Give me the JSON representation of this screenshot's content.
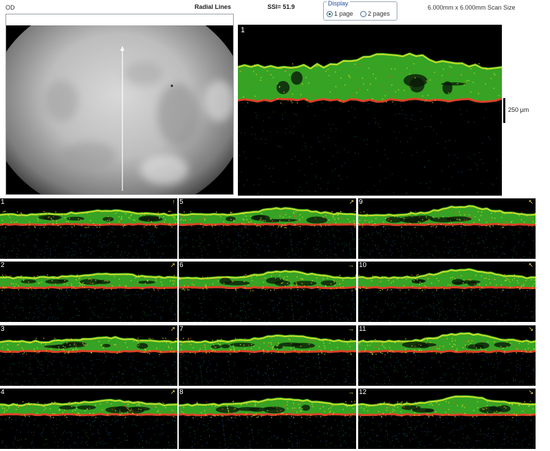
{
  "header": {
    "eye_label": "OD",
    "scan_pattern": "Radial Lines",
    "ssi": "SSI= 51.9",
    "scan_size": "6.000mm x 6.000mm Scan Size"
  },
  "display": {
    "legend": "Display",
    "option_1": "1 page",
    "option_2": "2 pages",
    "selected": "1 page"
  },
  "main_scan": {
    "number": "1",
    "scale_label": "250 µm"
  },
  "thumbnails": [
    {
      "number": "1",
      "arrow": "↑"
    },
    {
      "number": "5",
      "arrow": "↗"
    },
    {
      "number": "9",
      "arrow": "↖"
    },
    {
      "number": "2",
      "arrow": "↗"
    },
    {
      "number": "6",
      "arrow": "→"
    },
    {
      "number": "10",
      "arrow": "↖"
    },
    {
      "number": "3",
      "arrow": "↗"
    },
    {
      "number": "7",
      "arrow": "→"
    },
    {
      "number": "11",
      "arrow": "↘"
    },
    {
      "number": "4",
      "arrow": "↗"
    },
    {
      "number": "8",
      "arrow": "→"
    },
    {
      "number": "12",
      "arrow": "↘"
    }
  ],
  "colors": {
    "retina_green": "#3fbf2a",
    "retina_yellow": "#d7e62a",
    "rpe_orange": "#e0552a",
    "rpe_red": "#d61f1f"
  }
}
